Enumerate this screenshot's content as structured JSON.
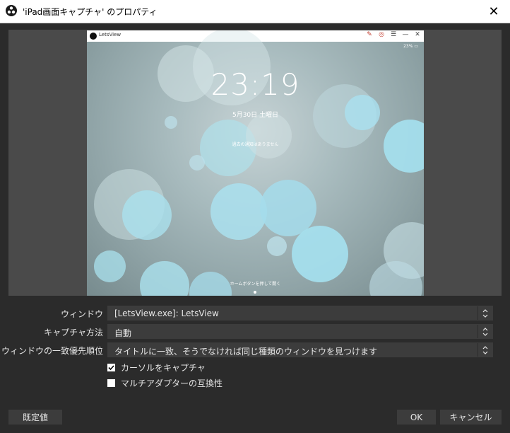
{
  "window": {
    "title": "'iPad画面キャプチャ' のプロパティ",
    "close_glyph": "✕"
  },
  "capture": {
    "app_name": "LetsView",
    "status": "23% ▭",
    "clock": "23:19",
    "date": "5月30日 土曜日",
    "notice": "過去の通知はありません",
    "home_hint": "ホームボタンを押して開く",
    "controls": [
      "✎",
      "◎",
      "☰",
      "—",
      "✕"
    ]
  },
  "properties": {
    "window_label": "ウィンドウ",
    "window_value": "[LetsView.exe]: LetsView",
    "capture_method_label": "キャプチャ方法",
    "capture_method_value": "自動",
    "priority_label": "ウィンドウの一致優先順位",
    "priority_value": "タイトルに一致、そうでなければ同じ種類のウィンドウを見つけます",
    "capture_cursor_label": "カーソルをキャプチャ",
    "capture_cursor_checked": true,
    "multi_adapter_label": "マルチアダプターの互換性",
    "multi_adapter_checked": false
  },
  "buttons": {
    "defaults": "既定値",
    "ok": "OK",
    "cancel": "キャンセル"
  },
  "colors": {
    "background": "#2b2b2b",
    "field": "#3c3c3c",
    "text": "#e6e6e6"
  }
}
